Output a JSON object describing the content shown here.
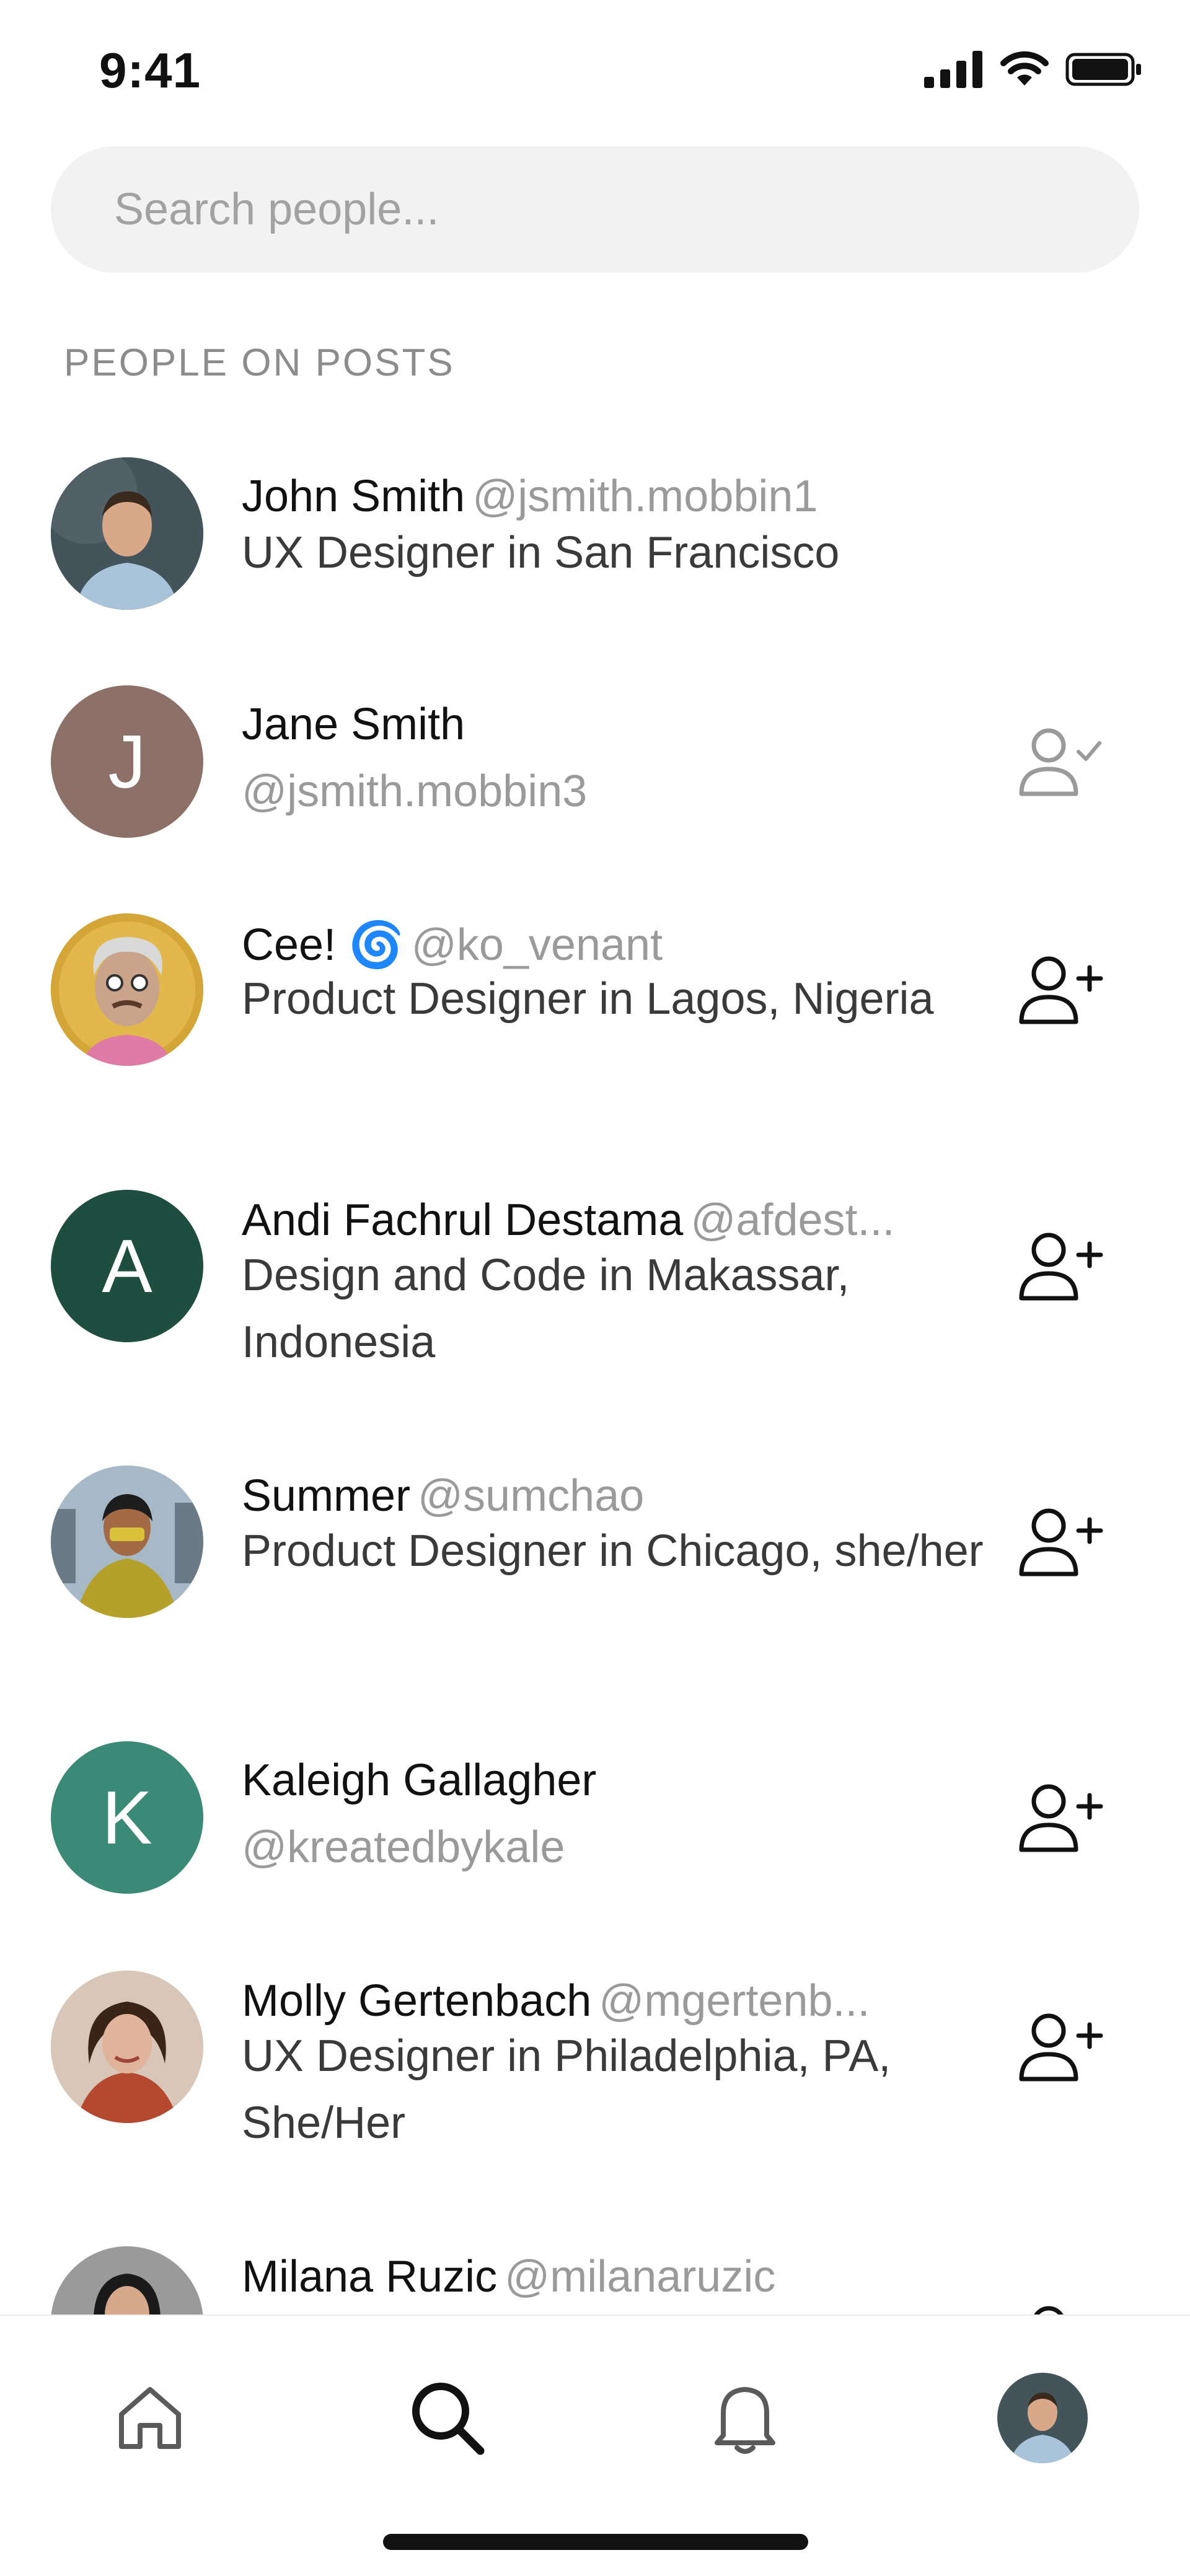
{
  "status_bar": {
    "time": "9:41"
  },
  "search": {
    "placeholder": "Search people..."
  },
  "section_title": "PEOPLE ON POSTS",
  "people": [
    {
      "name": "John Smith",
      "handle": "@jsmith.mobbin1",
      "bio": "UX Designer in San Francisco",
      "avatar": "photo",
      "action": "none"
    },
    {
      "name": "Jane Smith",
      "handle": "@jsmith.mobbin3",
      "bio": "",
      "avatar_initial": "J",
      "avatar_color": "#8d7068",
      "action": "following"
    },
    {
      "name": "Cee! 🌀",
      "handle": "@ko_venant",
      "bio": "Product Designer in Lagos, Nigeria",
      "avatar": "illustration",
      "action": "follow"
    },
    {
      "name": "Andi Fachrul Destama",
      "handle": "@afdest...",
      "bio": "Design and Code in Makassar, Indonesia",
      "avatar_initial": "A",
      "avatar_color": "#1f4d40",
      "action": "follow"
    },
    {
      "name": "Summer",
      "handle": "@sumchao",
      "bio": "Product Designer in Chicago, she/her",
      "avatar": "photo",
      "action": "follow"
    },
    {
      "name": "Kaleigh Gallagher",
      "handle": "@kreatedbykale",
      "bio": "",
      "avatar_initial": "K",
      "avatar_color": "#3b8a76",
      "action": "follow"
    },
    {
      "name": "Molly Gertenbach",
      "handle": "@mgertenb...",
      "bio": "UX Designer in Philadelphia, PA, She/Her",
      "avatar": "photo",
      "action": "follow"
    },
    {
      "name": "Milana Ruzic",
      "handle": "@milanaruzic",
      "bio": "",
      "avatar": "photo",
      "action": "follow"
    }
  ],
  "tab_bar": {
    "tabs": [
      "home-icon",
      "search-icon",
      "bell-icon",
      "profile-avatar"
    ],
    "active": "search-icon"
  },
  "colors": {
    "background": "#ffffff",
    "search_bg": "#f2f2f2",
    "muted_text": "#9a9a9a",
    "primary_text": "#111111"
  }
}
